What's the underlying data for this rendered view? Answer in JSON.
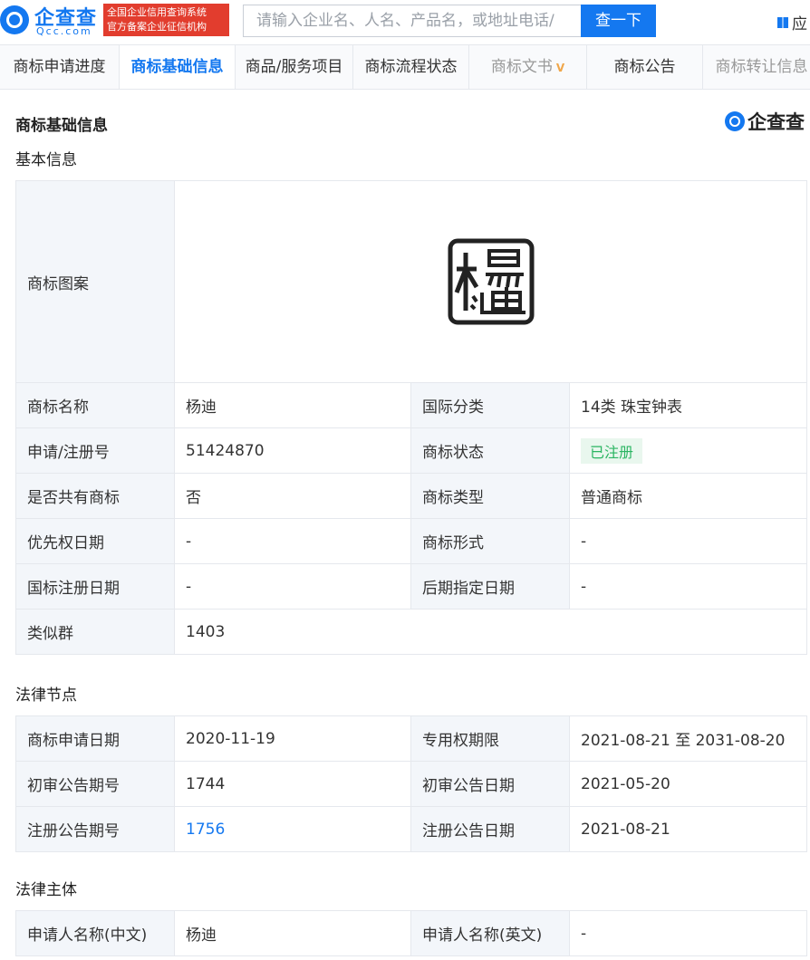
{
  "header": {
    "logo_text": "企查查",
    "logo_sub": "Qcc.com",
    "cert_line1": "全国企业信用查询系统",
    "cert_line2": "官方备案企业征信机构",
    "search_placeholder": "请输入企业名、人名、产品名，或地址电话/",
    "search_button": "查一下",
    "app_link": "应"
  },
  "tabs": [
    {
      "label": "商标申请进度"
    },
    {
      "label": "商标基础信息"
    },
    {
      "label": "商品/服务项目"
    },
    {
      "label": "商标流程状态"
    },
    {
      "label": "商标文书"
    },
    {
      "label": "商标公告"
    },
    {
      "label": "商标转让信息"
    }
  ],
  "page_title": "商标基础信息",
  "brand_text": "企查查",
  "basic": {
    "title": "基本信息",
    "image_label": "商标图案",
    "rows": [
      {
        "l1": "商标名称",
        "v1": "杨迪",
        "l2": "国际分类",
        "v2": "14类 珠宝钟表"
      },
      {
        "l1": "申请/注册号",
        "v1": "51424870",
        "l2": "商标状态",
        "v2": "已注册"
      },
      {
        "l1": "是否共有商标",
        "v1": "否",
        "l2": "商标类型",
        "v2": "普通商标"
      },
      {
        "l1": "优先权日期",
        "v1": "-",
        "l2": "商标形式",
        "v2": "-"
      },
      {
        "l1": "国标注册日期",
        "v1": "-",
        "l2": "后期指定日期",
        "v2": "-"
      }
    ],
    "similar_group_label": "类似群",
    "similar_group_value": "1403"
  },
  "legal_nodes": {
    "title": "法律节点",
    "rows": [
      {
        "l1": "商标申请日期",
        "v1": "2020-11-19",
        "l2": "专用权期限",
        "v2": "2021-08-21 至 2031-08-20"
      },
      {
        "l1": "初审公告期号",
        "v1": "1744",
        "l2": "初审公告日期",
        "v2": "2021-05-20"
      },
      {
        "l1": "注册公告期号",
        "v1": "1756",
        "l2": "注册公告日期",
        "v2": "2021-08-21"
      }
    ]
  },
  "legal_subject": {
    "title": "法律主体",
    "rows": [
      {
        "l1": "申请人名称(中文)",
        "v1": "杨迪",
        "l2": "申请人名称(英文)",
        "v2": "-"
      }
    ]
  },
  "colors": {
    "accent": "#1478f0",
    "status_green": "#2bb562",
    "cert_red": "#e23d2e"
  }
}
